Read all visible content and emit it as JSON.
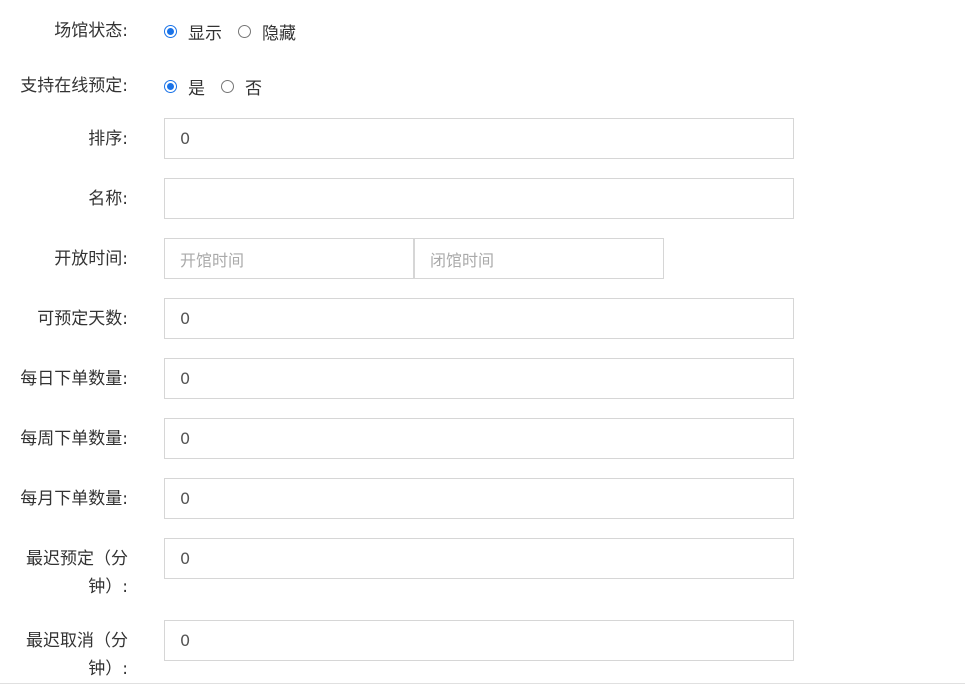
{
  "venue_status": {
    "label": "场馆状态:",
    "options": [
      {
        "label": "显示",
        "checked": true
      },
      {
        "label": "隐藏",
        "checked": false
      }
    ]
  },
  "online_booking": {
    "label": "支持在线预定:",
    "options": [
      {
        "label": "是",
        "checked": true
      },
      {
        "label": "否",
        "checked": false
      }
    ]
  },
  "sort": {
    "label": "排序:",
    "value": "0"
  },
  "name": {
    "label": "名称:",
    "value": ""
  },
  "open_time": {
    "label": "开放时间:",
    "start_placeholder": "开馆时间",
    "end_placeholder": "闭馆时间"
  },
  "bookable_days": {
    "label": "可预定天数:",
    "value": "0"
  },
  "daily_orders": {
    "label": "每日下单数量:",
    "value": "0"
  },
  "weekly_orders": {
    "label": "每周下单数量:",
    "value": "0"
  },
  "monthly_orders": {
    "label": "每月下单数量:",
    "value": "0"
  },
  "latest_booking": {
    "label_line1": "最迟预定（分",
    "label_line2": "钟）:",
    "value": "0"
  },
  "latest_cancel": {
    "label_line1": "最迟取消（分",
    "label_line2": "钟）:",
    "value": "0"
  },
  "colors": {
    "accent": "#1a73e8",
    "border": "#d6d6d6",
    "text": "#333333",
    "placeholder": "#aaaaaa"
  }
}
